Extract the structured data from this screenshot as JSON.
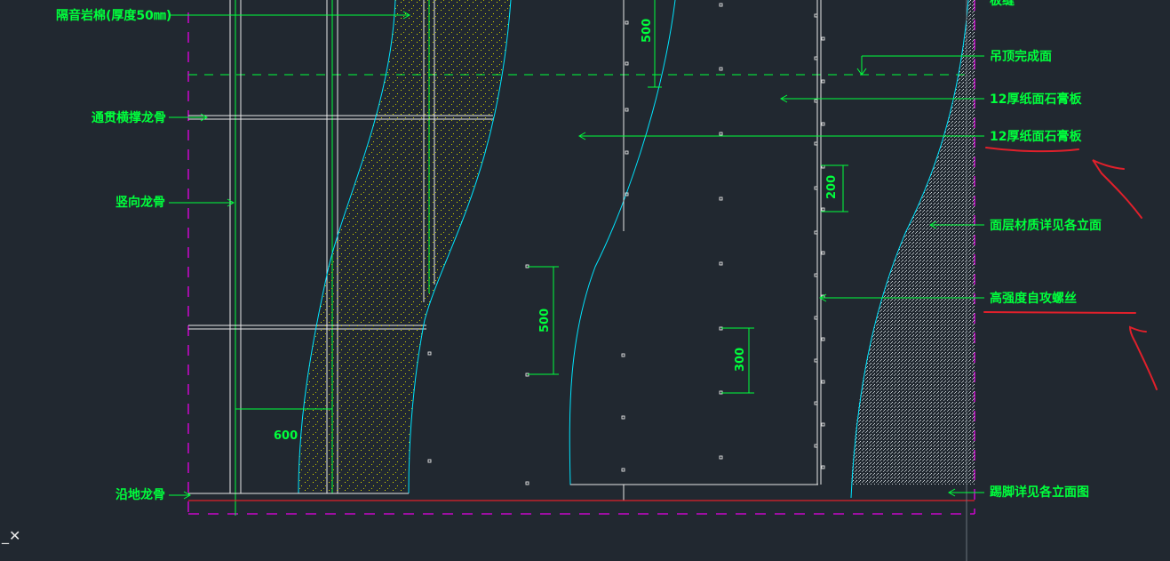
{
  "drawing": {
    "callouts": {
      "insulation": "隔音岩棉(厚度50㎜)",
      "cross_bracing_keel": "通贯横撑龙骨",
      "vertical_keel": "竖向龙骨",
      "floor_keel": "沿地龙骨",
      "board_joint": "板缝",
      "ceiling_finish": "吊顶完成面",
      "gypsum_board_1": "12厚纸面石膏板",
      "gypsum_board_2": "12厚纸面石膏板",
      "surface_material": "面层材质详见各立面",
      "screws": "高强度自攻螺丝",
      "skirting": "踢脚详见各立面图"
    },
    "dimensions": {
      "keel_spacing": "600",
      "top_board_span": "500",
      "screw_pitch_edge": "200",
      "screw_pitch_field_left": "500",
      "screw_pitch_field_center": "300"
    },
    "colors": {
      "background": "#212830",
      "text_and_dims": "#00ff3c",
      "board_outline": "#00e5ff",
      "boundary_dashed": "#e600e6",
      "floor_line": "#e0202b",
      "markup_annotation": "#e0202b",
      "structure_lines": "#ffffff"
    },
    "ucs_icon": "ucs-cross-icon"
  }
}
